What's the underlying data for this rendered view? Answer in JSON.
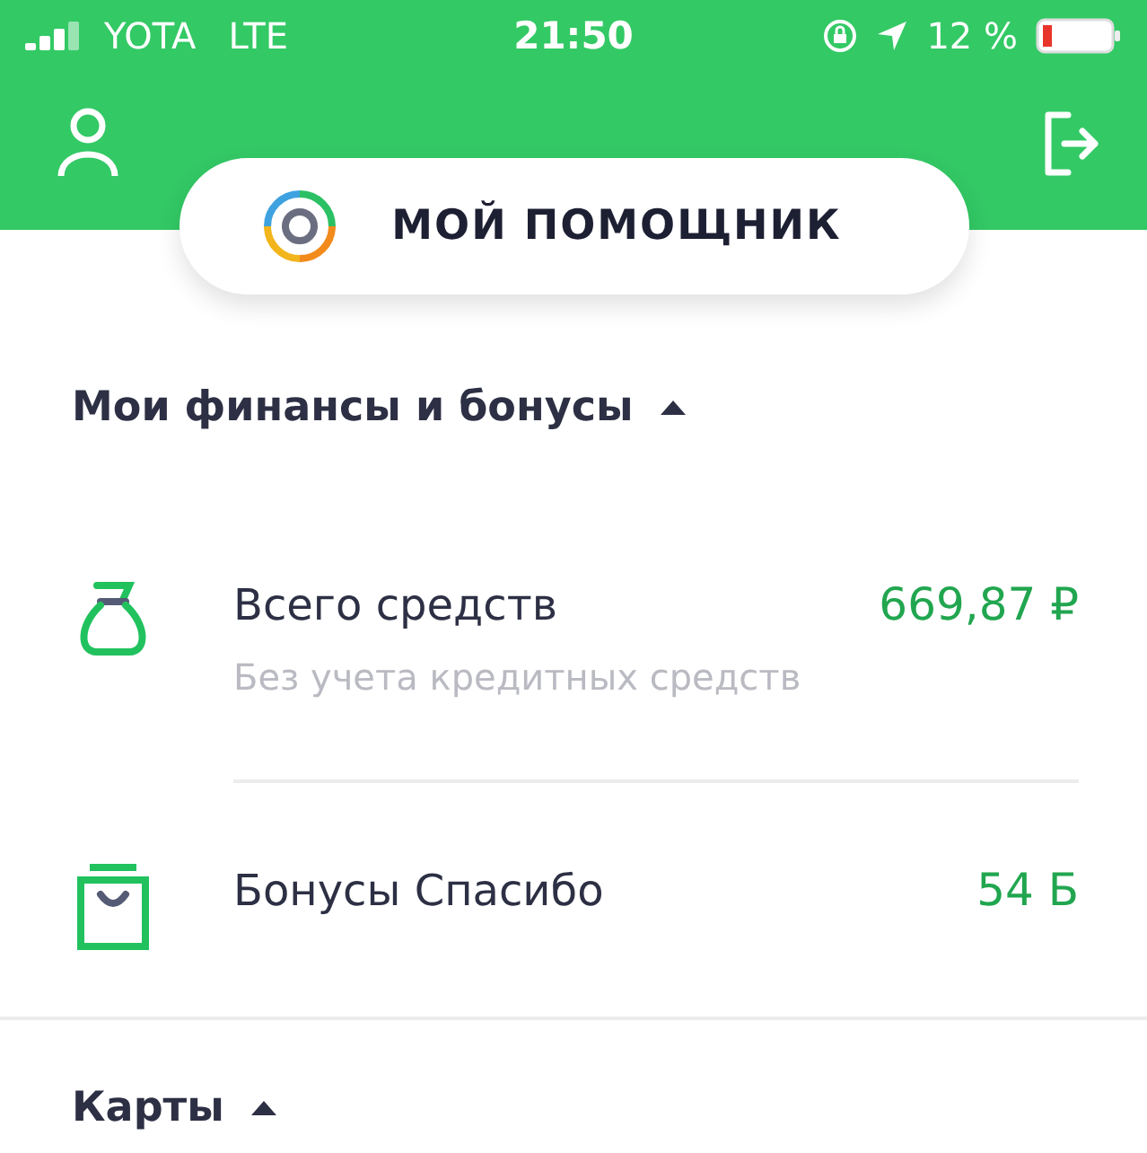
{
  "status_bar": {
    "carrier": "YOTA",
    "network": "LTE",
    "time": "21:50",
    "battery": "12 %"
  },
  "header": {
    "assistant_button": "МОЙ ПОМОЩНИК"
  },
  "sections": [
    {
      "title": "Мои финансы и бонусы",
      "expanded": true,
      "items": [
        {
          "kind": "money",
          "title": "Всего средств",
          "subtitle": "Без учета кредитных средств",
          "amount": "669,87 ₽"
        },
        {
          "kind": "bonus",
          "title": "Бонусы Спасибо",
          "amount": "54 Б"
        }
      ]
    },
    {
      "title": "Карты",
      "expanded": true
    }
  ]
}
